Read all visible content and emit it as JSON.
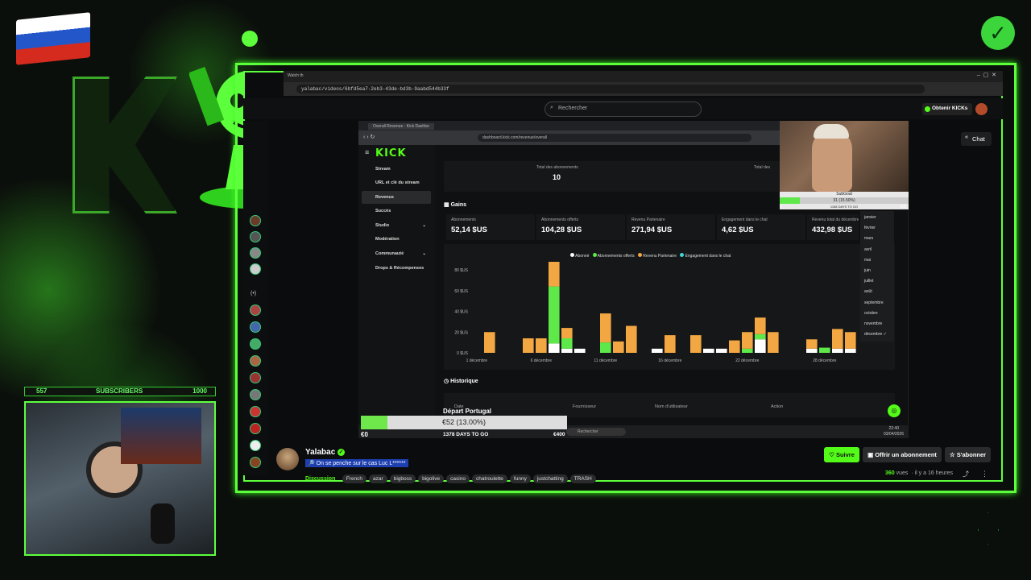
{
  "browser": {
    "tab_title": "Watch th",
    "url": "yalabac/videos/6bfd5ea7-2eb3-43de-bd3b-9aabd544b33f"
  },
  "kick_header": {
    "search_placeholder": "Rechercher",
    "kicks_button": "Obtenir KICKs",
    "chat_button": "Chat"
  },
  "overlay": {
    "subscribers_label": "SUBSCRIBERS",
    "subscribers_count": "557",
    "subscribers_goal": "1000"
  },
  "inner_browser": {
    "tab_title": "Overall Revenue - Kick Dashbo",
    "url": "dashboard.kick.com/revenue/overall"
  },
  "dashboard": {
    "logo": "KICK",
    "sidebar": [
      {
        "label": "Stream"
      },
      {
        "label": "URL et clé du stream"
      },
      {
        "label": "Revenus",
        "active": true
      },
      {
        "label": "Succès"
      },
      {
        "label": "Studio"
      },
      {
        "label": "Modération"
      },
      {
        "label": "Communauté"
      },
      {
        "label": "Drops & Récompenses"
      }
    ],
    "total_subs_label": "Total des abonnements",
    "total_subs_value": "10",
    "total_label_2": "Total des",
    "gains_title": "Gains",
    "stats": [
      {
        "label": "Abonnements",
        "value": "52,14 $US"
      },
      {
        "label": "Abonnements offerts",
        "value": "104,28 $US"
      },
      {
        "label": "Revenu Partenaire",
        "value": "271,94 $US"
      },
      {
        "label": "Engagement dans le chat",
        "value": "4,62 $US"
      },
      {
        "label": "Revenu total du décembre",
        "value": "432,98 $US"
      }
    ],
    "months": [
      "janvier",
      "février",
      "mars",
      "avril",
      "mai",
      "juin",
      "juillet",
      "août",
      "septembre",
      "octobre",
      "novembre",
      "décembre ✓"
    ],
    "history_title": "Historique",
    "history_cols": [
      "Date",
      "Fournisseur",
      "Nom d'utilisateur",
      "Action"
    ]
  },
  "chart_data": {
    "type": "bar",
    "stacked": true,
    "legend": [
      "Abonné",
      "Abonnements offerts",
      "Revenu Partenaire",
      "Engagement dans le chat"
    ],
    "colors": {
      "Abonné": "#ffffff",
      "Abonnements offerts": "#5ee84a",
      "Revenu Partenaire": "#f2a742",
      "Engagement dans le chat": "#3fd6d6"
    },
    "y_ticks": [
      "0 $US",
      "20 $US",
      "40 $US",
      "60 $US",
      "80 $US"
    ],
    "ylim": [
      0,
      80
    ],
    "x_tick_labels": [
      "1 décembre",
      "6 décembre",
      "11 décembre",
      "16 décembre",
      "22 décembre",
      "28 décembre"
    ],
    "series": [
      {
        "name": "Abonné",
        "values": [
          0,
          0,
          0,
          0,
          0,
          0,
          9,
          4,
          4,
          0,
          0,
          0,
          0,
          0,
          4,
          0,
          0,
          0,
          4,
          4,
          0,
          0,
          13,
          0,
          0,
          0,
          4,
          0,
          4,
          4
        ]
      },
      {
        "name": "Abonnements offerts",
        "values": [
          0,
          0,
          0,
          0,
          0,
          0,
          55,
          10,
          0,
          0,
          10,
          0,
          0,
          0,
          0,
          0,
          0,
          0,
          0,
          0,
          0,
          4,
          5,
          0,
          0,
          0,
          0,
          5,
          0,
          0
        ]
      },
      {
        "name": "Revenu Partenaire",
        "values": [
          0,
          20,
          0,
          0,
          14,
          14,
          24,
          10,
          0,
          0,
          28,
          11,
          26,
          0,
          0,
          17,
          0,
          17,
          0,
          0,
          12,
          16,
          16,
          20,
          0,
          0,
          9,
          0,
          19,
          16
        ]
      },
      {
        "name": "Engagement dans le chat",
        "values": [
          0,
          0,
          0,
          0,
          0,
          0,
          0,
          0,
          0,
          0,
          0,
          0,
          0,
          0,
          0,
          0,
          0,
          0,
          0,
          0,
          0,
          0,
          0,
          0,
          0,
          0,
          0,
          0,
          0,
          0
        ]
      }
    ]
  },
  "taskbar": {
    "search": "Rechercher",
    "time": "22:40",
    "date": "03/04/2026"
  },
  "goal_overlay": {
    "title": "Départ Portugal",
    "amount": "€52 (13.00%)",
    "start": "€0",
    "end": "€400",
    "days": "1378 DAYS TO GO",
    "progress": 0.13
  },
  "subgoal_overlay": {
    "title": "SubGoal",
    "value": "31 (15.50%)",
    "days": "1158 DAYS TO GO",
    "start": "0",
    "end": "200",
    "progress": 0.155
  },
  "streamer": {
    "name": "Yalabac",
    "title": "🔎 On se penche sur le cas Luc L******",
    "category": "Discussion",
    "tags": [
      "French",
      "azar",
      "bigboss",
      "bigolive",
      "casino",
      "chatroulette",
      "funny",
      "justchatting",
      "TRASH"
    ],
    "views_count": "360",
    "views_label": "vues",
    "time_ago": "il y a 16 heures",
    "follow_button": "Suivre",
    "gift_button": "Offrir un abonnement",
    "subscribe_button": "S'abonner"
  }
}
